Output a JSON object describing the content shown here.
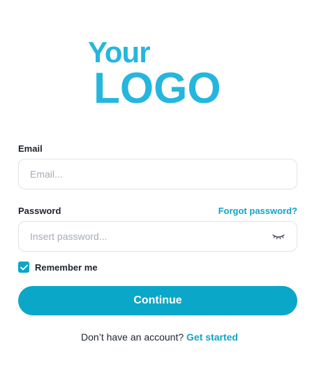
{
  "logo": {
    "line1": "Your",
    "line2": "LOGO"
  },
  "email": {
    "label": "Email",
    "placeholder": "Email...",
    "value": ""
  },
  "password": {
    "label": "Password",
    "placeholder": "Insert password...",
    "value": "",
    "forgot_link": "Forgot password?"
  },
  "remember": {
    "label": "Remember me",
    "checked": true
  },
  "continue_label": "Continue",
  "signup": {
    "prompt": "Don’t have an account?",
    "link": "Get started"
  },
  "colors": {
    "accent": "#0ba7c8",
    "logo": "#25b6dd",
    "text": "#1f2330",
    "placeholder": "#a7acb6",
    "border": "#dfe2e8"
  },
  "icons": {
    "password_toggle": "eye-closed-icon",
    "checkbox": "check-icon"
  }
}
